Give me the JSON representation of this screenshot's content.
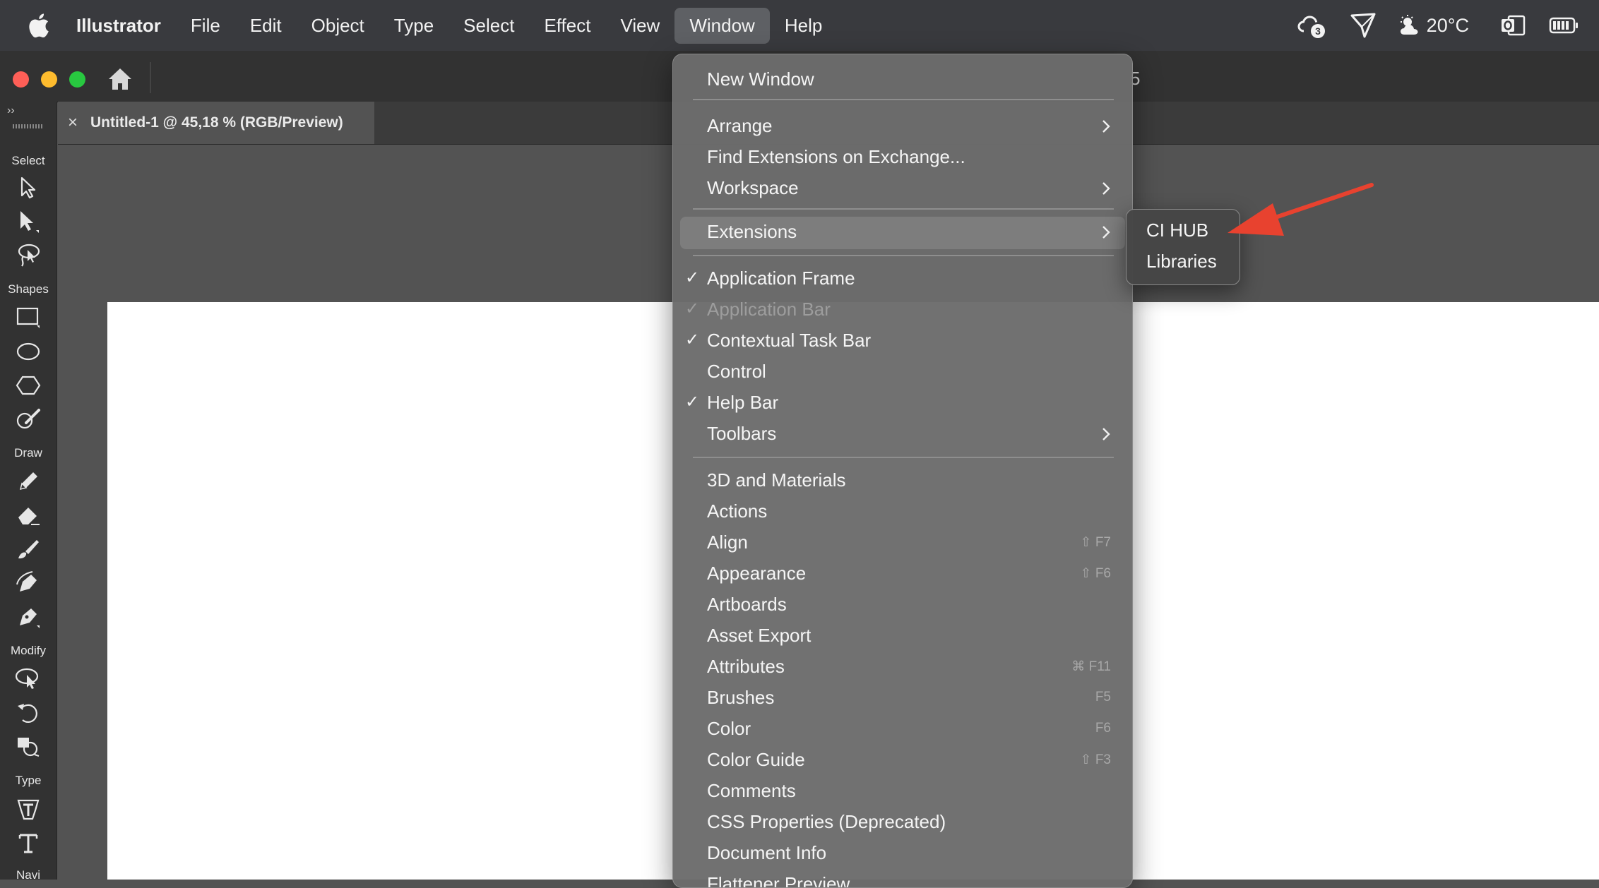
{
  "menubar": {
    "app_name": "Illustrator",
    "items": [
      {
        "label": "File"
      },
      {
        "label": "Edit"
      },
      {
        "label": "Object"
      },
      {
        "label": "Type"
      },
      {
        "label": "Select"
      },
      {
        "label": "Effect"
      },
      {
        "label": "View"
      },
      {
        "label": "Window",
        "active": true
      },
      {
        "label": "Help"
      }
    ],
    "status": {
      "cloud_badge": "3",
      "weather_temp": "20°C",
      "icons": [
        "cloud-sync-icon",
        "messenger-icon",
        "weather-icon",
        "outlook-icon",
        "battery-icon"
      ]
    }
  },
  "titlebar": {
    "title_fragment": "5"
  },
  "document_tab": {
    "close_glyph": "×",
    "title": "Untitled-1 @ 45,18 % (RGB/Preview)"
  },
  "toolbar": {
    "collapse_glyph": "››",
    "sections": [
      "Select",
      "Shapes",
      "Draw",
      "Modify",
      "Type",
      "Navi"
    ],
    "tools": [
      "selection-tool-icon",
      "direct-selection-tool-icon",
      "lasso-tool-icon",
      "rectangle-tool-icon",
      "ellipse-tool-icon",
      "polygon-tool-icon",
      "shaper-tool-icon",
      "pencil-tool-icon",
      "eraser-tool-icon",
      "paintbrush-tool-icon",
      "curvature-tool-icon",
      "pen-tool-icon",
      "zoom-select-tool-icon",
      "rotate-tool-icon",
      "shape-builder-tool-icon",
      "touch-type-tool-icon",
      "type-tool-icon"
    ]
  },
  "window_menu": {
    "checkmark": "✓",
    "items": [
      {
        "label": "New Window"
      },
      {
        "label": "Arrange",
        "submenu": true
      },
      {
        "label": "Find Extensions on Exchange..."
      },
      {
        "label": "Workspace",
        "submenu": true
      },
      {
        "label": "Extensions",
        "submenu": true,
        "highlighted": true
      },
      {
        "label": "Application Frame",
        "checked": true
      },
      {
        "label": "Application Bar",
        "checked": true,
        "disabled": true
      },
      {
        "label": "Contextual Task Bar",
        "checked": true
      },
      {
        "label": "Control"
      },
      {
        "label": "Help Bar",
        "checked": true
      },
      {
        "label": "Toolbars",
        "submenu": true
      },
      {
        "label": "3D and Materials"
      },
      {
        "label": "Actions"
      },
      {
        "label": "Align",
        "shortcut": "⇧ F7"
      },
      {
        "label": "Appearance",
        "shortcut": "⇧ F6"
      },
      {
        "label": "Artboards"
      },
      {
        "label": "Asset Export"
      },
      {
        "label": "Attributes",
        "shortcut": "⌘ F11"
      },
      {
        "label": "Brushes",
        "shortcut": "F5"
      },
      {
        "label": "Color",
        "shortcut": "F6"
      },
      {
        "label": "Color Guide",
        "shortcut": "⇧ F3"
      },
      {
        "label": "Comments"
      },
      {
        "label": "CSS Properties (Deprecated)"
      },
      {
        "label": "Document Info"
      },
      {
        "label": "Flattener Preview"
      }
    ]
  },
  "extensions_submenu": {
    "items": [
      {
        "label": "CI HUB"
      },
      {
        "label": "Libraries"
      }
    ]
  },
  "colors": {
    "menubar_bg": "#393a3e",
    "menu_bg": "#6c6c6c",
    "highlight": "#7d7d7d",
    "artboard": "#ffffff",
    "arrow": "#e8422f",
    "traffic_close": "#fe5f57",
    "traffic_min": "#febc2e",
    "traffic_max": "#28c840"
  }
}
